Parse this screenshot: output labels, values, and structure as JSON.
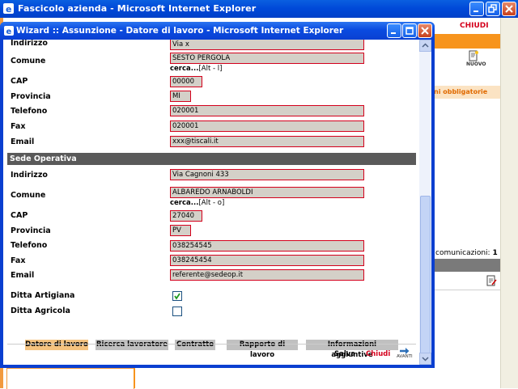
{
  "outer": {
    "title": "Fascicolo azienda - Microsoft Internet Explorer",
    "chiudi": "CHIUDI",
    "nuovo": "NUOVO",
    "obbligatorie": "ni obbligatorie",
    "comunicazioni_label": "comunicazioni:",
    "comunicazioni_count": "1"
  },
  "popup": {
    "title": "Wizard :: Assunzione - Datore di lavoro - Microsoft Internet Explorer"
  },
  "form": {
    "labels": {
      "indirizzo": "Indirizzo",
      "comune": "Comune",
      "cap": "CAP",
      "provincia": "Provincia",
      "telefono": "Telefono",
      "fax": "Fax",
      "email": "Email",
      "ditta_artigiana": "Ditta Artigiana",
      "ditta_agricola": "Ditta Agricola"
    },
    "sede_legale": {
      "indirizzo": "Via x",
      "comune": "SESTO PERGOLA",
      "cerca_link": "cerca...",
      "cerca_shortcut": "[Alt - l]",
      "cap": "00000",
      "provincia": "MI",
      "telefono": "020001",
      "fax": "020001",
      "email": "xxx@tiscali.it"
    },
    "sede_operativa_title": "Sede Operativa",
    "sede_operativa": {
      "indirizzo": "Via Cagnoni 433",
      "comune": "ALBAREDO ARNABOLDI",
      "cerca_link": "cerca...",
      "cerca_shortcut": "[Alt - o]",
      "cap": "27040",
      "provincia": "PV",
      "telefono": "038254545",
      "fax": "038245454",
      "email": "referente@sedeop.it"
    },
    "ditta_artigiana_checked": true,
    "ditta_agricola_checked": false
  },
  "tabs": [
    {
      "label": "Datore di lavoro",
      "active": true
    },
    {
      "label": "Ricerca lavoratore",
      "active": false
    },
    {
      "label": "Contratto",
      "active": false
    },
    {
      "label": "Rapporto di lavoro",
      "active": false
    },
    {
      "label": "Informazioni aggiuntive",
      "active": false
    }
  ],
  "footer": {
    "salva": "Salva",
    "chiudi": "Chiudi",
    "avanti": "AVANTI"
  },
  "colors": {
    "titlebar_blue": "#0a4be0",
    "field_border_red": "#d4001c",
    "field_bg": "#d4d0c8",
    "active_tab": "#f4c27f",
    "section_header": "#5a5a5a",
    "accent_orange": "#f7941d"
  }
}
